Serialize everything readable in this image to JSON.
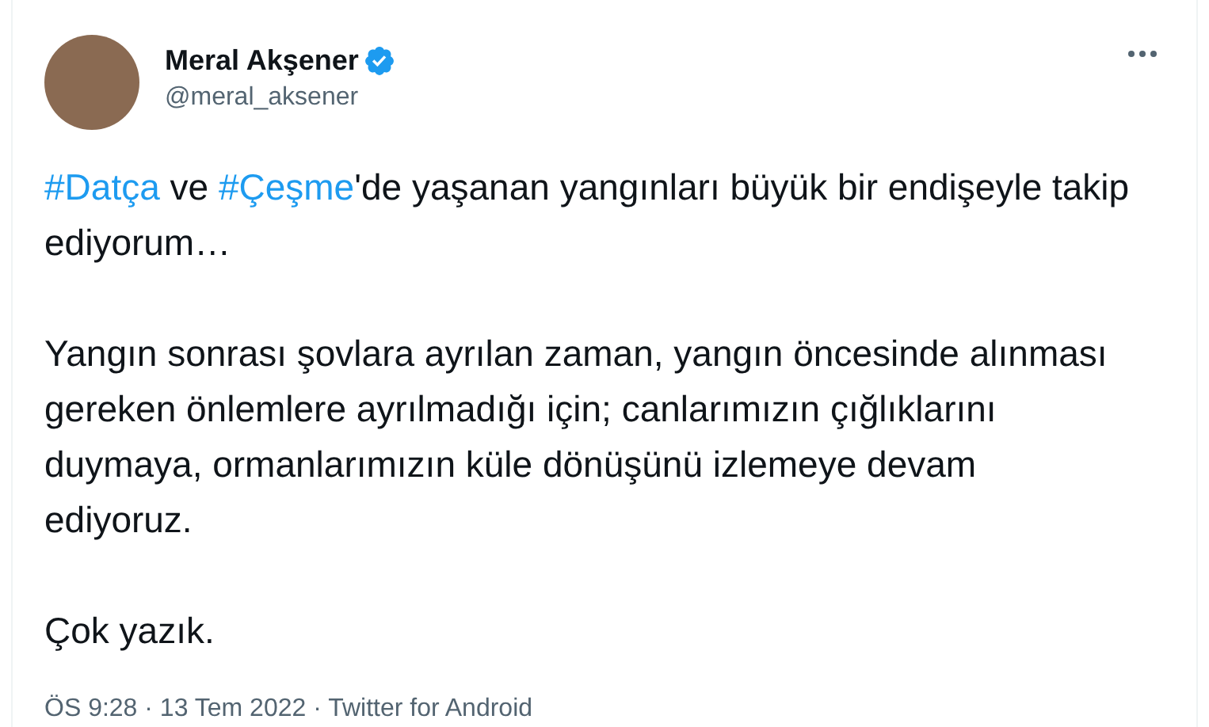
{
  "author": {
    "name": "Meral Akşener",
    "verified": true,
    "handle": "@meral_aksener"
  },
  "paragraphs": [
    [
      {
        "kind": "hashtag",
        "text": "#Datça"
      },
      {
        "kind": "text",
        "text": " ve "
      },
      {
        "kind": "hashtag",
        "text": "#Çeşme"
      },
      {
        "kind": "text",
        "text": "'de yaşanan yangınları büyük bir endişeyle takip ediyorum…"
      }
    ],
    [
      {
        "kind": "text",
        "text": "Yangın sonrası şovlara ayrılan zaman, yangın öncesinde alınması gereken önlemlere ayrılmadığı için; canlarımızın çığlıklarını duymaya, ormanlarımızın küle dönüşünü izlemeye devam ediyoruz."
      }
    ],
    [
      {
        "kind": "text",
        "text": "Çok yazık."
      }
    ]
  ],
  "footer": "ÖS 9:28 · 13 Tem 2022 · Twitter for Android"
}
